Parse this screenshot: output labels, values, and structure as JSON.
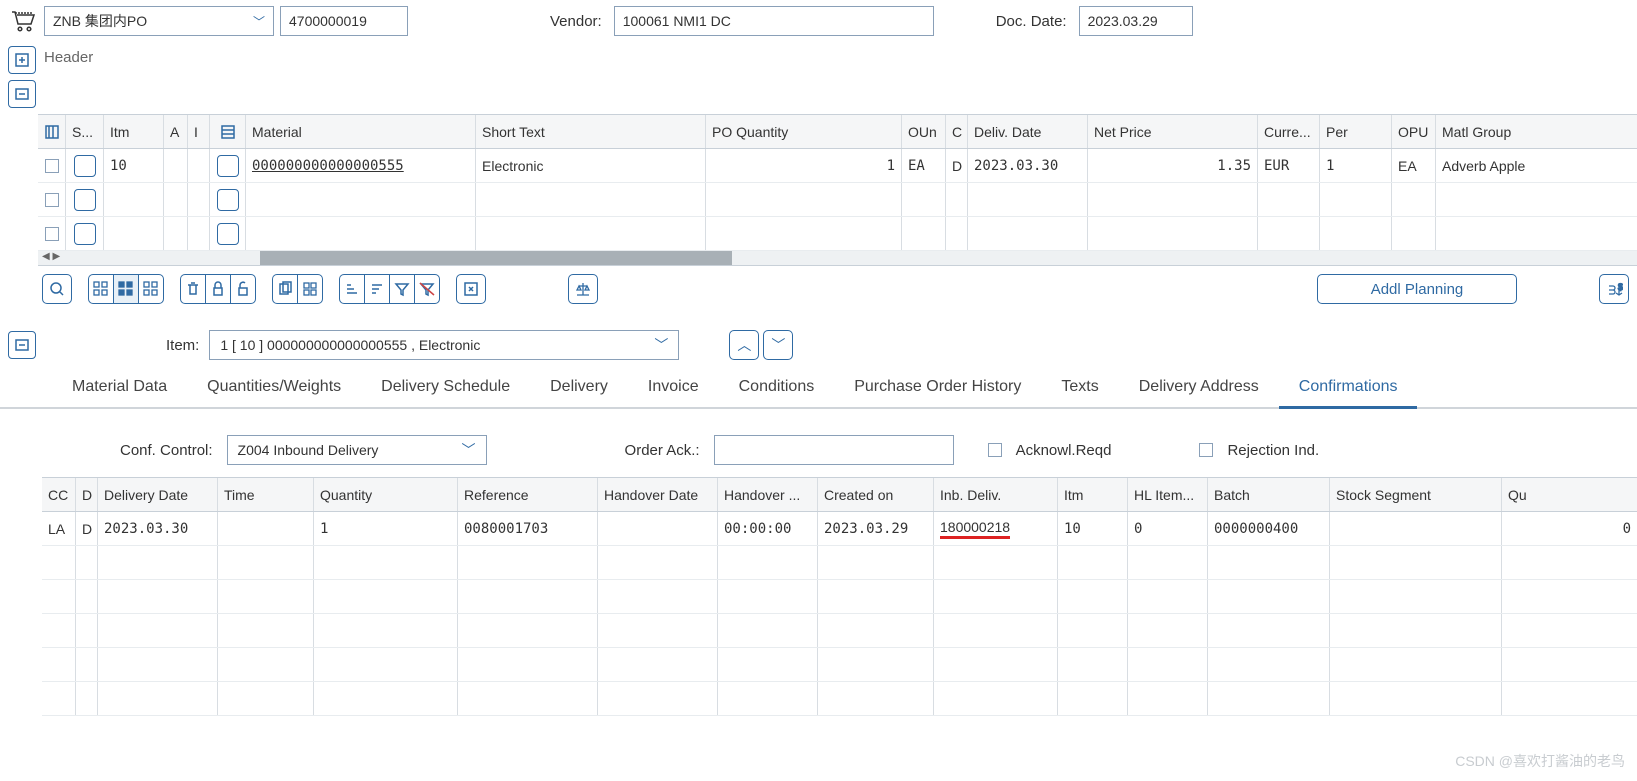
{
  "header": {
    "po_type": "ZNB 集团内PO",
    "po_number": "4700000019",
    "vendor_label": "Vendor:",
    "vendor_value": "100061 NMI1 DC",
    "doc_date_label": "Doc. Date:",
    "doc_date_value": "2023.03.29",
    "header_label": "Header"
  },
  "grid": {
    "cols": {
      "s": "S...",
      "itm": "Itm",
      "a": "A",
      "i": "I",
      "material": "Material",
      "short_text": "Short Text",
      "po_qty": "PO Quantity",
      "oun": "OUn",
      "c": "C",
      "deliv_date": "Deliv. Date",
      "net_price": "Net Price",
      "curre": "Curre...",
      "per": "Per",
      "opu": "OPU",
      "matl_group": "Matl Group"
    },
    "rows": [
      {
        "itm": "10",
        "material": "000000000000000555",
        "short_text": "Electronic",
        "po_qty": "1",
        "oun": "EA",
        "c": "D",
        "deliv_date": "2023.03.30",
        "net_price": "1.35",
        "curre": "EUR",
        "per": "1",
        "opu": "EA",
        "matl_group": "Adverb Apple"
      }
    ]
  },
  "toolbar": {
    "addl_planning": "Addl Planning"
  },
  "item_area": {
    "item_label": "Item:",
    "item_value": "1 [ 10 ] 000000000000000555 , Electronic"
  },
  "tabs": [
    {
      "label": "Material Data"
    },
    {
      "label": "Quantities/Weights"
    },
    {
      "label": "Delivery Schedule"
    },
    {
      "label": "Delivery"
    },
    {
      "label": "Invoice"
    },
    {
      "label": "Conditions"
    },
    {
      "label": "Purchase Order History"
    },
    {
      "label": "Texts"
    },
    {
      "label": "Delivery Address"
    },
    {
      "label": "Confirmations",
      "active": true
    }
  ],
  "conf_ctrl": {
    "label": "Conf. Control:",
    "value": "Z004 Inbound Delivery",
    "order_ack_label": "Order Ack.:",
    "ack_reqd": "Acknowl.Reqd",
    "rej_ind": "Rejection Ind."
  },
  "conf_grid": {
    "cols": {
      "cc": "CC",
      "d": "D",
      "delivery_date": "Delivery Date",
      "time": "Time",
      "qty": "Quantity",
      "ref": "Reference",
      "handover_date": "Handover Date",
      "handover": "Handover ...",
      "created_on": "Created on",
      "inb_deliv": "Inb. Deliv.",
      "itm": "Itm",
      "hl_item": "HL Item...",
      "batch": "Batch",
      "stock_seg": "Stock Segment",
      "qu": "Qu"
    },
    "rows": [
      {
        "cc": "LA",
        "d": "D",
        "delivery_date": "2023.03.30",
        "time": "",
        "qty": "1",
        "ref": "0080001703",
        "handover_date": "",
        "handover": "00:00:00",
        "created_on": "2023.03.29",
        "inb_deliv": "180000218",
        "itm": "10",
        "hl_item": "0",
        "batch": "0000000400",
        "stock_seg": "",
        "qu": "0"
      }
    ]
  },
  "watermark": "CSDN @喜欢打酱油的老鸟"
}
